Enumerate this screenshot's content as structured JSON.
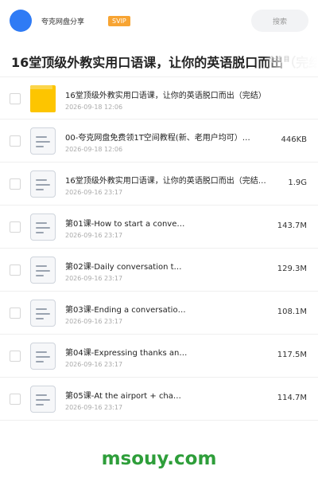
{
  "header": {
    "app_name": "夸克网盘分享",
    "badge": "SVIP",
    "search_placeholder": "搜索"
  },
  "title": "16堂顶级外教实用口语课，让你的英语脱口而出（完结）、",
  "tabs_hint": "全部 目",
  "files": [
    {
      "type": "folder",
      "name": "16堂顶级外教实用口语课，让你的英语脱口而出（完结）",
      "date": "2026-09-18 12:06",
      "size": ""
    },
    {
      "type": "doc",
      "name": "00-夸克网盘免费领1T空间教程(新、老用户均可）…",
      "date": "2026-09-18 12:06",
      "size": "446KB"
    },
    {
      "type": "doc",
      "name": "16堂顶级外教实用口语课，让你的英语脱口而出（完结…",
      "date": "2026-09-16 23:17",
      "size": "1.9G"
    },
    {
      "type": "doc",
      "name": "第01课-How to start a conve…",
      "date": "2026-09-16 23:17",
      "size": "143.7M"
    },
    {
      "type": "doc",
      "name": "第02课-Daily conversation t…",
      "date": "2026-09-16 23:17",
      "size": "129.3M"
    },
    {
      "type": "doc",
      "name": "第03课-Ending a conversatio…",
      "date": "2026-09-16 23:17",
      "size": "108.1M"
    },
    {
      "type": "doc",
      "name": "第04课-Expressing thanks an…",
      "date": "2026-09-16 23:17",
      "size": "117.5M"
    },
    {
      "type": "doc",
      "name": "第05课-At the airport + cha…",
      "date": "2026-09-16 23:17",
      "size": "114.7M"
    }
  ],
  "footer": {
    "brand": "msouy.com"
  },
  "colors": {
    "accent": "#2f7bf5",
    "badge": "#f7a433",
    "folder": "#fdc500",
    "brand_green": "#2e9e3a"
  }
}
